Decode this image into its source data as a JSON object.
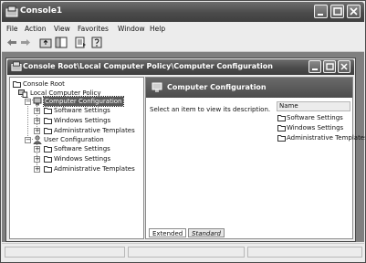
{
  "app": {
    "title": "Console1"
  },
  "menu": [
    "File",
    "Action",
    "View",
    "Favorites",
    "Window",
    "Help"
  ],
  "child": {
    "title": "Console Root\\Local Computer Policy\\Computer Configuration"
  },
  "tree": {
    "root": "Console Root",
    "policy": "Local Computer Policy",
    "computer_config": "Computer Configuration",
    "computer_children": [
      "Software Settings",
      "Windows Settings",
      "Administrative Templates"
    ],
    "user_config": "User Configuration",
    "user_children": [
      "Software Settings",
      "Windows Settings",
      "Administrative Templates"
    ]
  },
  "detail": {
    "title": "Computer Configuration",
    "description": "Select an item to view its description.",
    "column_name": "Name",
    "items": [
      "Software Settings",
      "Windows Settings",
      "Administrative Templates"
    ]
  },
  "tabs": {
    "extended": "Extended",
    "standard": "Standard"
  },
  "icons": {
    "app": "console-icon",
    "back": "back-arrow-icon",
    "forward": "forward-arrow-icon",
    "up": "up-folder-icon",
    "show_hide_tree": "tree-icon",
    "export": "export-list-icon",
    "help": "help-icon"
  }
}
